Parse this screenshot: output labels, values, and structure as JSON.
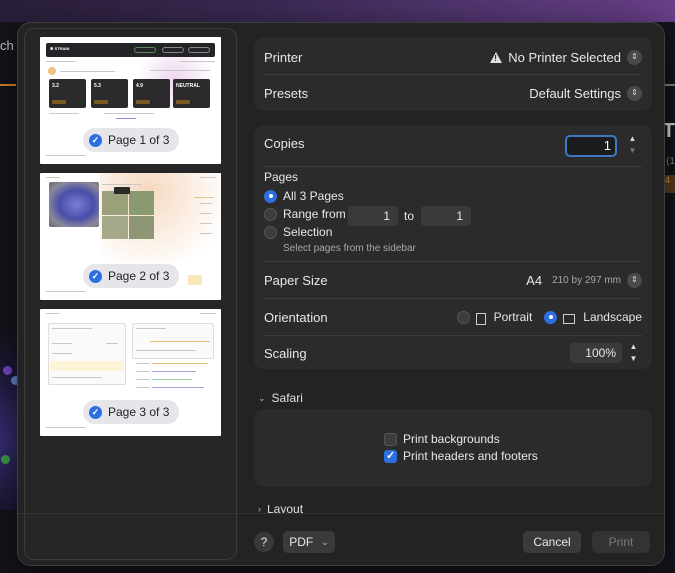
{
  "background": {
    "left_text": "ch",
    "right_text": "UT",
    "right_chip": "4",
    "right_gray": "(1"
  },
  "sidebar": {
    "pages": [
      {
        "label": "Page 1 of 3"
      },
      {
        "label": "Page 2 of 3"
      },
      {
        "label": "Page 3 of 3"
      }
    ],
    "thumb1": {
      "logo": "✱ STRAIN",
      "cards": [
        "3.2",
        "5.3",
        "4.9",
        "NEUTRAL"
      ]
    }
  },
  "printer": {
    "label": "Printer",
    "value": "No Printer Selected"
  },
  "presets": {
    "label": "Presets",
    "value": "Default Settings"
  },
  "copies": {
    "label": "Copies",
    "value": "1"
  },
  "pages": {
    "label": "Pages",
    "all": "All 3 Pages",
    "range_from": "Range from",
    "range_start": "1",
    "range_to": "to",
    "range_end": "1",
    "selection": "Selection",
    "selection_hint": "Select pages from the sidebar"
  },
  "paper_size": {
    "label": "Paper Size",
    "value": "A4",
    "detail": "210 by 297 mm"
  },
  "orientation": {
    "label": "Orientation",
    "portrait": "Portrait",
    "landscape": "Landscape",
    "selected": "landscape"
  },
  "scaling": {
    "label": "Scaling",
    "value": "100%"
  },
  "safari": {
    "title": "Safari",
    "print_backgrounds": "Print backgrounds",
    "print_headers": "Print headers and footers",
    "backgrounds_checked": false,
    "headers_checked": true
  },
  "layout": {
    "title": "Layout"
  },
  "footer": {
    "help": "?",
    "pdf": "PDF",
    "cancel": "Cancel",
    "print": "Print"
  },
  "colors": {
    "accent": "#2d6fe0",
    "dialog_bg": "#232323",
    "group_bg": "#2b2b2b"
  }
}
